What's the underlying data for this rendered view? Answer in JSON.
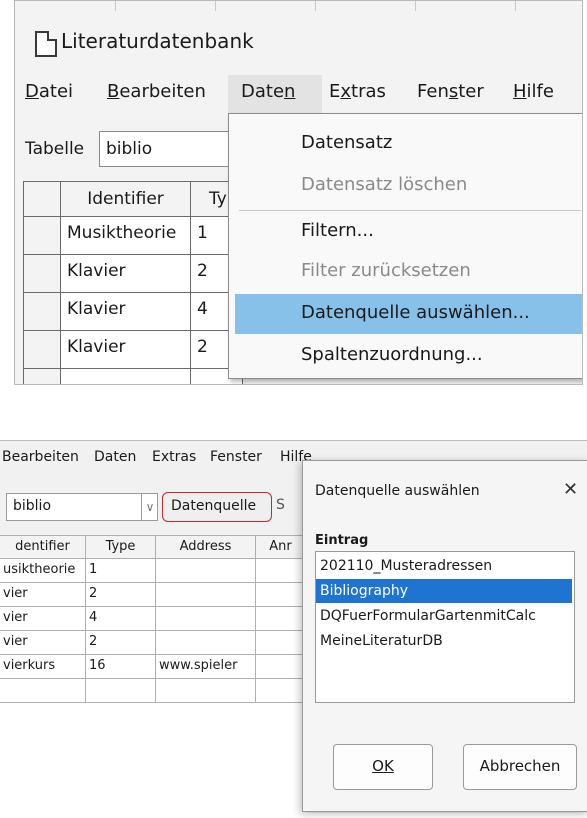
{
  "top": {
    "window_title": "Literaturdatenbank",
    "menu": [
      {
        "label": "Datei",
        "pre": "",
        "ul": "D",
        "post": "atei"
      },
      {
        "label": "Bearbeiten",
        "pre": "",
        "ul": "B",
        "post": "earbeiten"
      },
      {
        "label": "Daten",
        "pre": "Date",
        "ul": "n",
        "post": ""
      },
      {
        "label": "Extras",
        "pre": "E",
        "ul": "x",
        "post": "tras"
      },
      {
        "label": "Fenster",
        "pre": "Fen",
        "ul": "s",
        "post": "ter"
      },
      {
        "label": "Hilfe",
        "pre": "",
        "ul": "H",
        "post": "ilfe"
      }
    ],
    "table_label": "Tabelle",
    "table_value": "biblio",
    "grid_headers": [
      "Identifier",
      "Ty"
    ],
    "grid_rows": [
      [
        "Musiktheorie",
        "1"
      ],
      [
        "Klavier",
        "2"
      ],
      [
        "Klavier",
        "4"
      ],
      [
        "Klavier",
        "2"
      ]
    ],
    "dropdown": [
      {
        "label": "Datensatz",
        "enabled": true
      },
      {
        "label": "Datensatz löschen",
        "enabled": false
      },
      {
        "label": "Filtern...",
        "enabled": true
      },
      {
        "label": "Filter zurücksetzen",
        "enabled": false
      },
      {
        "label": "Datenquelle auswählen...",
        "enabled": true,
        "highlighted": true
      },
      {
        "label": "Spaltenzuordnung...",
        "enabled": true
      }
    ]
  },
  "bottom": {
    "menu": [
      "Bearbeiten",
      "Daten",
      "Extras",
      "Fenster",
      "Hilfe"
    ],
    "table_value": "biblio",
    "datasource_button": "Datenquelle",
    "grid_headers": [
      "dentifier",
      "Type",
      "Address",
      "Anr"
    ],
    "grid_rows": [
      [
        "usiktheorie",
        "1",
        "",
        ""
      ],
      [
        "vier",
        "2",
        "",
        ""
      ],
      [
        "vier",
        "4",
        "",
        ""
      ],
      [
        "vier",
        "2",
        "",
        ""
      ],
      [
        "vierkurs",
        "16",
        "www.spieler",
        ""
      ]
    ]
  },
  "dialog": {
    "title": "Datenquelle auswählen",
    "close_glyph": "✕",
    "list_label": "Eintrag",
    "entries": [
      "202110_Musteradressen",
      "Bibliography",
      "DQFuerFormularGartenmitCalc",
      "MeineLiteraturDB"
    ],
    "selected_index": 1,
    "ok": "OK",
    "cancel": "Abbrechen"
  }
}
